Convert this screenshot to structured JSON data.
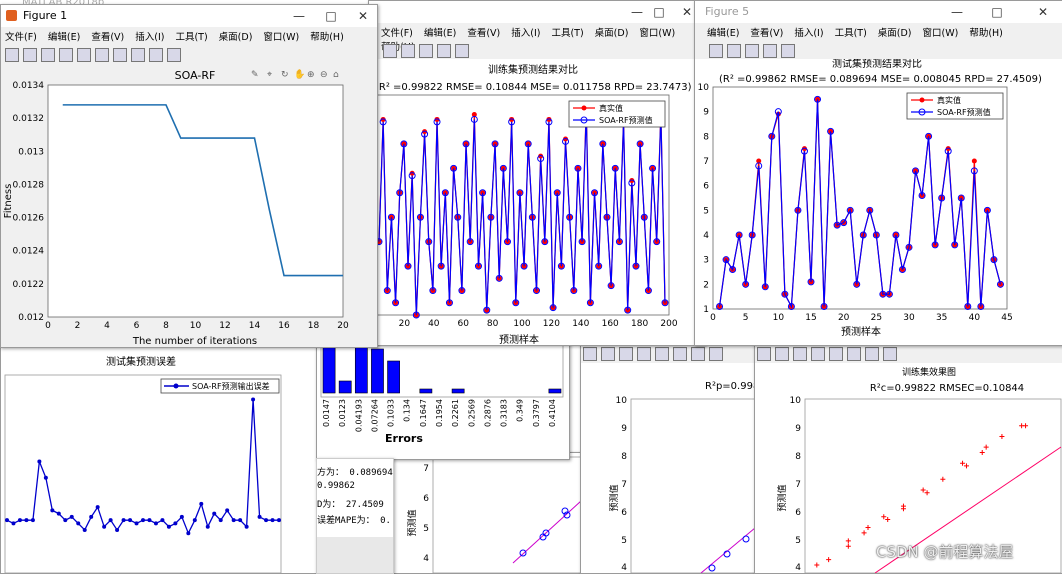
{
  "desktop": {
    "top_caption": "MATLAB R2018b",
    "watermark": "CSDN @前程算法屋",
    "partial_menu_left": "文件(F)"
  },
  "menus": {
    "file": "文件(F)",
    "edit": "编辑(E)",
    "view": "查看(V)",
    "insert": "插入(I)",
    "tools": "工具(T)",
    "desktop": "桌面(D)",
    "window": "窗口(W)",
    "help": "帮助(H)"
  },
  "window_controls": {
    "minimize": "—",
    "maximize": "□",
    "close": "✕"
  },
  "figure1": {
    "title": "Figure 1",
    "plot_title": "SOA-RF",
    "xlabel": "The number of iterations",
    "ylabel": "Fitness",
    "x_ticks": [
      "0",
      "2",
      "4",
      "6",
      "8",
      "10",
      "12",
      "14",
      "16",
      "18",
      "20"
    ],
    "y_ticks": [
      "0.012",
      "0.0122",
      "0.0124",
      "0.0126",
      "0.0128",
      "0.013",
      "0.0132",
      "0.0134"
    ]
  },
  "figure_train": {
    "title": "",
    "plot_title": "训练集预测结果对比",
    "subtitle": "(R² =0.99822 RMSE= 0.10844 MSE= 0.011758 RPD= 23.7473)",
    "xlabel": "预测样本",
    "x_ticks": [
      "20",
      "40",
      "60",
      "80",
      "100",
      "120",
      "140",
      "160",
      "180",
      "200"
    ],
    "legend": [
      "真实值",
      "SOA-RF预测值"
    ]
  },
  "figure_test": {
    "title": "Figure 5",
    "plot_title": "测试集预测结果对比",
    "subtitle": "(R² =0.99862 RMSE= 0.089694 MSE= 0.008045 RPD= 27.4509)",
    "xlabel": "预测样本",
    "x_ticks": [
      "0",
      "5",
      "10",
      "15",
      "20",
      "25",
      "30",
      "35",
      "40",
      "45"
    ],
    "y_ticks": [
      "1",
      "2",
      "3",
      "4",
      "5",
      "6",
      "7",
      "8",
      "9",
      "10"
    ],
    "legend": [
      "真实值",
      "SOA-RF预测值"
    ]
  },
  "figure_error": {
    "plot_title": "测试集预测误差",
    "legend": [
      "SOA-RF预测输出误差"
    ]
  },
  "figure_hist": {
    "xlabel": "Errors",
    "x_ticks": [
      "0.0147",
      "0.0123",
      "0.04193",
      "0.07264",
      "0.1033",
      "0.134",
      "0.1647",
      "0.1954",
      "0.2261",
      "0.2569",
      "0.2876",
      "0.3183",
      "0.349",
      "0.3797",
      "0.4104"
    ]
  },
  "command_window": {
    "lines": [
      "方为：   0.089694",
      "          0.99862",
      "D为：   27.4509",
      "误差MAPE为：    0."
    ]
  },
  "partial_label": "2  预测样本",
  "figure_scatter_test": {
    "ylabel": "预测值",
    "title_partial": "R²p=0.9986",
    "y_ticks": [
      "4",
      "5",
      "6",
      "7",
      "8",
      "9",
      "10"
    ]
  },
  "figure_scatter_train": {
    "title": "R²c=0.99822  RMSEC=0.10844",
    "title_left_partial": "训练集效果图",
    "ylabel": "预测值",
    "y_ticks": [
      "4",
      "5",
      "6",
      "7",
      "8",
      "9",
      "10"
    ]
  },
  "figure_mid_scatter": {
    "ylabel": "预测值",
    "y_ticks": [
      "4",
      "5",
      "6",
      "7"
    ]
  },
  "chart_data": [
    {
      "type": "line",
      "title": "SOA-RF",
      "xlabel": "The number of iterations",
      "ylabel": "Fitness",
      "xlim": [
        0,
        20
      ],
      "ylim": [
        0.012,
        0.0134
      ],
      "x": [
        1,
        2,
        3,
        4,
        5,
        6,
        7,
        8,
        9,
        10,
        11,
        12,
        13,
        14,
        15,
        16,
        17,
        18,
        19,
        20
      ],
      "values": [
        0.01328,
        0.01328,
        0.01328,
        0.01328,
        0.01328,
        0.01328,
        0.01328,
        0.01328,
        0.01308,
        0.01308,
        0.01308,
        0.01308,
        0.01308,
        0.01308,
        0.01265,
        0.01225,
        0.01225,
        0.01225,
        0.01225,
        0.01225
      ],
      "color": "#1f6fb0"
    },
    {
      "type": "line",
      "title": "测试集预测结果对比",
      "xlabel": "预测样本",
      "xlim": [
        0,
        45
      ],
      "ylim": [
        1,
        10
      ],
      "series": [
        {
          "name": "真实值",
          "color": "#ff0000",
          "values": [
            1.1,
            3.0,
            2.6,
            4.0,
            2.0,
            4.0,
            7.0,
            1.9,
            8.0,
            8.9,
            1.6,
            1.1,
            5.0,
            7.5,
            2.1,
            9.5,
            1.1,
            8.2,
            4.4,
            4.5,
            5.0,
            2.0,
            4.0,
            5.0,
            4.0,
            1.6,
            1.6,
            4.0,
            2.6,
            3.5,
            6.6,
            5.6,
            8.0,
            3.6,
            5.5,
            7.5,
            3.6,
            5.5,
            1.1,
            7.0,
            1.1,
            5.0,
            3.0,
            2.0
          ]
        },
        {
          "name": "SOA-RF预测值",
          "color": "#0000ff",
          "values": [
            1.1,
            3.0,
            2.6,
            4.0,
            2.0,
            4.0,
            6.8,
            1.9,
            8.0,
            9.0,
            1.6,
            1.1,
            5.0,
            7.4,
            2.1,
            9.5,
            1.1,
            8.2,
            4.4,
            4.5,
            5.0,
            2.0,
            4.0,
            5.0,
            4.0,
            1.6,
            1.6,
            4.0,
            2.6,
            3.5,
            6.6,
            5.6,
            8.0,
            3.6,
            5.5,
            7.4,
            3.6,
            5.5,
            1.1,
            6.6,
            1.1,
            5.0,
            3.0,
            2.0
          ]
        }
      ]
    },
    {
      "type": "line",
      "title": "测试集预测误差",
      "series": [
        {
          "name": "SOA-RF预测输出误差",
          "color": "#0000cc",
          "values": [
            0.02,
            0.01,
            0.02,
            0.02,
            0.02,
            0.2,
            0.15,
            0.05,
            0.04,
            0.02,
            0.03,
            0.01,
            -0.01,
            0.03,
            0.06,
            0.0,
            0.02,
            -0.01,
            0.02,
            0.02,
            0.01,
            0.02,
            0.02,
            0.01,
            0.02,
            0.0,
            0.01,
            0.03,
            -0.02,
            0.02,
            0.07,
            0.0,
            0.04,
            0.02,
            0.05,
            0.02,
            0.02,
            0.0,
            0.39,
            0.03,
            0.02,
            0.02,
            0.02
          ]
        }
      ]
    },
    {
      "type": "line",
      "title": "训练集预测结果对比",
      "xlabel": "预测样本",
      "xlim": [
        0,
        200
      ],
      "ylim": [
        1,
        10
      ],
      "series": [
        {
          "name": "真实值",
          "color": "#ff0000",
          "values": [
            4,
            9,
            2,
            5,
            1.5,
            6,
            8,
            3,
            6.8,
            1,
            5,
            8.5,
            4,
            2,
            9,
            3,
            6,
            1.5,
            7,
            5,
            2,
            8,
            4,
            9.2,
            3,
            6,
            1.2,
            5,
            8,
            2.5,
            7,
            4,
            9,
            1.5,
            6,
            3,
            8,
            5,
            2,
            7.5,
            4,
            9,
            1.3,
            6,
            3,
            8.2,
            5,
            2,
            7,
            4,
            9.5,
            1.5,
            6,
            3,
            8,
            5,
            2.2,
            7,
            4,
            9,
            1.2,
            6.5,
            3,
            8,
            5,
            2,
            7,
            4,
            9.3,
            1.5
          ]
        },
        {
          "name": "SOA-RF预测值",
          "color": "#0000ff",
          "values": [
            4,
            8.9,
            2,
            5,
            1.5,
            6,
            8,
            3,
            6.7,
            1,
            5,
            8.4,
            4,
            2,
            8.9,
            3,
            6,
            1.5,
            7,
            5,
            2,
            8,
            4,
            9,
            3,
            6,
            1.2,
            5,
            8,
            2.5,
            7,
            4,
            8.9,
            1.5,
            6,
            3,
            8,
            5,
            2,
            7.4,
            4,
            8.9,
            1.3,
            6,
            3,
            8.1,
            5,
            2,
            7,
            4,
            9.3,
            1.5,
            6,
            3,
            8,
            5,
            2.2,
            7,
            4,
            8.9,
            1.2,
            6.4,
            3,
            8,
            5,
            2,
            7,
            4,
            9.2,
            1.5
          ]
        }
      ]
    },
    {
      "type": "bar",
      "xlabel": "Errors",
      "categories": [
        "0.0147",
        "0.0123",
        "0.04193",
        "0.07264",
        "0.1033",
        "0.134",
        "0.1647",
        "0.1954",
        "0.2261",
        "0.2569",
        "0.2876",
        "0.3183",
        "0.349",
        "0.3797",
        "0.4104"
      ],
      "values": [
        24,
        3,
        14,
        11,
        8,
        0,
        1,
        0,
        1,
        0,
        0,
        0,
        0,
        0,
        1
      ]
    },
    {
      "type": "scatter",
      "title": "训练集效果图",
      "ylim": [
        3.5,
        10
      ],
      "series": [
        {
          "name": "points",
          "color": "#ff0000",
          "points": [
            [
              3.8,
              3.8
            ],
            [
              4.1,
              4.0
            ],
            [
              4.6,
              4.7
            ],
            [
              4.6,
              4.5
            ],
            [
              5.0,
              5.0
            ],
            [
              5.1,
              5.2
            ],
            [
              5.5,
              5.6
            ],
            [
              5.6,
              5.5
            ],
            [
              6.0,
              6.0
            ],
            [
              6.0,
              5.9
            ],
            [
              6.5,
              6.6
            ],
            [
              6.6,
              6.5
            ],
            [
              7.0,
              7.0
            ],
            [
              7.5,
              7.6
            ],
            [
              7.6,
              7.5
            ],
            [
              8.0,
              8.0
            ],
            [
              8.1,
              8.2
            ],
            [
              8.5,
              8.6
            ],
            [
              9.0,
              9.0
            ],
            [
              9.1,
              9.0
            ]
          ]
        }
      ]
    }
  ]
}
